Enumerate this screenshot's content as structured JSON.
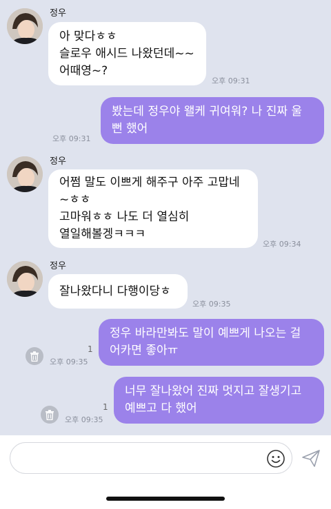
{
  "conversation": {
    "messages": [
      {
        "sender": "정우",
        "direction": "received",
        "lines": [
          "아 맞다ㅎㅎ",
          "슬로우 애시드 나왔던데~~",
          "어때영~?"
        ],
        "time": "오후 09:31"
      },
      {
        "direction": "sent",
        "lines": [
          "봤는데 정우야 왤케 귀여워? 나 진짜 울",
          "뻔 했어"
        ],
        "time": "오후 09:31"
      },
      {
        "sender": "정우",
        "direction": "received",
        "lines": [
          "어쩜 말도 이쁘게 해주구 아주 고맙네",
          "~ㅎㅎ",
          "고마워ㅎㅎ 나도 더 열심히",
          "열일해볼겡ㅋㅋㅋ"
        ],
        "time": "오후 09:34"
      },
      {
        "sender": "정우",
        "direction": "received",
        "lines": [
          "잘나왔다니 다행이당ㅎ"
        ],
        "time": "오후 09:35"
      },
      {
        "direction": "sent",
        "lines": [
          "정우 바라만봐도 말이 예쁘게 나오는 걸",
          "어카면 좋아ㅠ"
        ],
        "time": "오후 09:35",
        "unread": "1"
      },
      {
        "direction": "sent",
        "lines": [
          "너무 잘나왔어 진짜 멋지고 잘생기고",
          "예쁘고 다 했어"
        ],
        "time": "오후 09:35",
        "unread": "1"
      }
    ]
  },
  "composer": {
    "input_value": ""
  },
  "icons": {
    "emoji": "emoji-icon",
    "send": "send-icon",
    "delete": "trash-icon"
  },
  "colors": {
    "background": "#dfe3ee",
    "sent_bubble": "#9b82ea",
    "received_bubble": "#ffffff"
  }
}
